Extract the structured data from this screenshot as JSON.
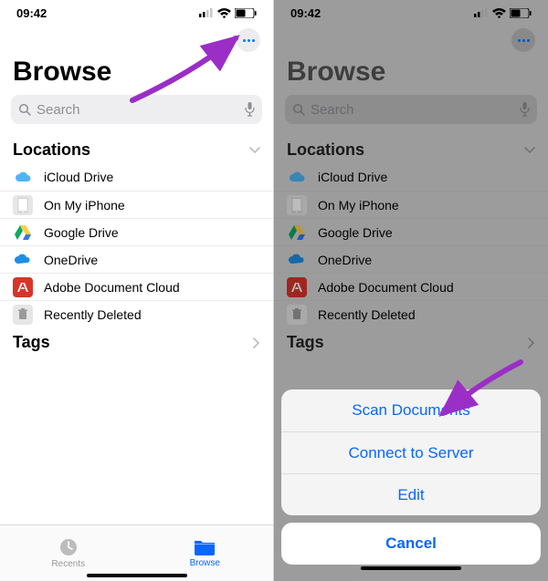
{
  "status": {
    "time": "09:42"
  },
  "browse": {
    "title": "Browse",
    "search_placeholder": "Search"
  },
  "sections": {
    "locations_label": "Locations",
    "tags_label": "Tags"
  },
  "locations": [
    {
      "label": "iCloud Drive"
    },
    {
      "label": "On My iPhone"
    },
    {
      "label": "Google Drive"
    },
    {
      "label": "OneDrive"
    },
    {
      "label": "Adobe Document Cloud"
    },
    {
      "label": "Recently Deleted"
    }
  ],
  "tabs": {
    "recents": "Recents",
    "browse": "Browse"
  },
  "actionsheet": {
    "scan": "Scan Documents",
    "connect": "Connect to Server",
    "edit": "Edit",
    "cancel": "Cancel"
  }
}
